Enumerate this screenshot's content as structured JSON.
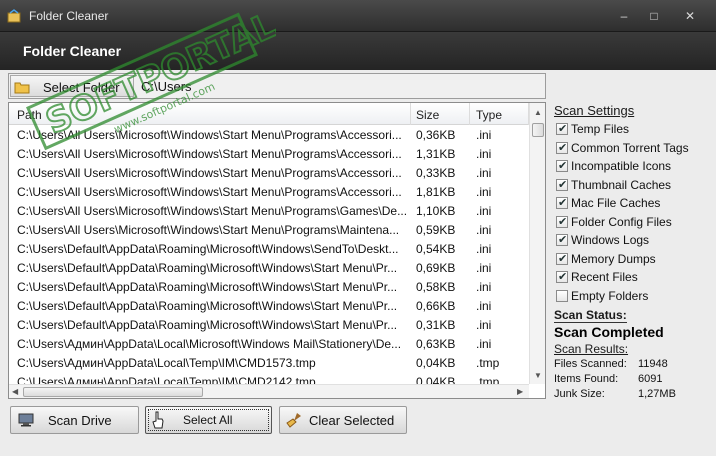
{
  "window": {
    "title": "Folder Cleaner",
    "minimize": "–",
    "maximize": "□",
    "close": "✕"
  },
  "header": {
    "title": "Folder Cleaner"
  },
  "pathbar": {
    "select_folder_label": "Select Folder",
    "path": "C:\\Users",
    "icon": "folder-icon"
  },
  "list": {
    "columns": [
      "Path",
      "Size",
      "Type"
    ],
    "rows": [
      {
        "path": "C:\\Users\\All Users\\Microsoft\\Windows\\Start Menu\\Programs\\Accessori...",
        "size": "0,36KB",
        "type": ".ini"
      },
      {
        "path": "C:\\Users\\All Users\\Microsoft\\Windows\\Start Menu\\Programs\\Accessori...",
        "size": "1,31KB",
        "type": ".ini"
      },
      {
        "path": "C:\\Users\\All Users\\Microsoft\\Windows\\Start Menu\\Programs\\Accessori...",
        "size": "0,33KB",
        "type": ".ini"
      },
      {
        "path": "C:\\Users\\All Users\\Microsoft\\Windows\\Start Menu\\Programs\\Accessori...",
        "size": "1,81KB",
        "type": ".ini"
      },
      {
        "path": "C:\\Users\\All Users\\Microsoft\\Windows\\Start Menu\\Programs\\Games\\De...",
        "size": "1,10KB",
        "type": ".ini"
      },
      {
        "path": "C:\\Users\\All Users\\Microsoft\\Windows\\Start Menu\\Programs\\Maintena...",
        "size": "0,59KB",
        "type": ".ini"
      },
      {
        "path": "C:\\Users\\Default\\AppData\\Roaming\\Microsoft\\Windows\\SendTo\\Deskt...",
        "size": "0,54KB",
        "type": ".ini"
      },
      {
        "path": "C:\\Users\\Default\\AppData\\Roaming\\Microsoft\\Windows\\Start Menu\\Pr...",
        "size": "0,69KB",
        "type": ".ini"
      },
      {
        "path": "C:\\Users\\Default\\AppData\\Roaming\\Microsoft\\Windows\\Start Menu\\Pr...",
        "size": "0,58KB",
        "type": ".ini"
      },
      {
        "path": "C:\\Users\\Default\\AppData\\Roaming\\Microsoft\\Windows\\Start Menu\\Pr...",
        "size": "0,66KB",
        "type": ".ini"
      },
      {
        "path": "C:\\Users\\Default\\AppData\\Roaming\\Microsoft\\Windows\\Start Menu\\Pr...",
        "size": "0,31KB",
        "type": ".ini"
      },
      {
        "path": "C:\\Users\\Админ\\AppData\\Local\\Microsoft\\Windows Mail\\Stationery\\De...",
        "size": "0,63KB",
        "type": ".ini"
      },
      {
        "path": "C:\\Users\\Админ\\AppData\\Local\\Temp\\IM\\CMD1573.tmp",
        "size": "0,04KB",
        "type": ".tmp"
      },
      {
        "path": "C:\\Users\\Админ\\AppData\\Local\\Temp\\IM\\CMD2142.tmp",
        "size": "0,04KB",
        "type": ".tmp"
      }
    ]
  },
  "settings": {
    "title": "Scan Settings",
    "items": [
      {
        "label": "Temp Files",
        "checked": true
      },
      {
        "label": "Common Torrent Tags",
        "checked": true
      },
      {
        "label": "Incompatible Icons",
        "checked": true
      },
      {
        "label": "Thumbnail Caches",
        "checked": true
      },
      {
        "label": "Mac File Caches",
        "checked": true
      },
      {
        "label": "Folder Config Files",
        "checked": true
      },
      {
        "label": "Windows Logs",
        "checked": true
      },
      {
        "label": "Memory Dumps",
        "checked": true
      },
      {
        "label": "Recent Files",
        "checked": true
      },
      {
        "label": "Empty Folders",
        "checked": false
      }
    ]
  },
  "status": {
    "title": "Scan Status:",
    "value": "Scan Completed"
  },
  "results": {
    "title": "Scan Results:",
    "files_scanned_label": "Files Scanned:",
    "files_scanned": "11948",
    "items_found_label": "Items Found:",
    "items_found": "6091",
    "junk_size_label": "Junk Size:",
    "junk_size": "1,27MB"
  },
  "buttons": {
    "scan_drive": "Scan Drive",
    "select_all": "Select All",
    "clear_selected": "Clear Selected"
  },
  "watermark": {
    "brand": "SOFTPORTAL",
    "url": "www.softportal.com"
  },
  "colors": {
    "title_bg": "#2e2e2e",
    "panel_bg": "#ececec",
    "watermark": "#2e8b2e"
  }
}
